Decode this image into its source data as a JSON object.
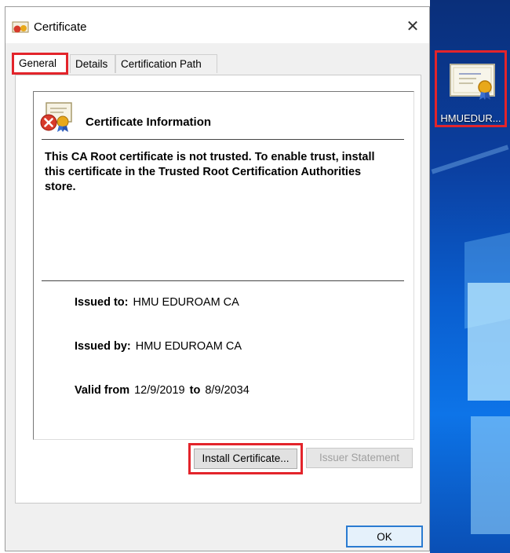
{
  "window": {
    "title": "Certificate",
    "close_symbol": "✕"
  },
  "tabs": [
    {
      "label": "General"
    },
    {
      "label": "Details"
    },
    {
      "label": "Certification Path"
    }
  ],
  "certificate": {
    "section_title": "Certificate Information",
    "warning": "This CA Root certificate is not trusted. To enable trust, install this certificate in the Trusted Root Certification Authorities store.",
    "issued_to_label": "Issued to:",
    "issued_to": "HMU EDUROAM CA",
    "issued_by_label": "Issued by:",
    "issued_by": "HMU EDUROAM CA",
    "valid_from_label": "Valid from",
    "valid_from": "12/9/2019",
    "valid_to_label": "to",
    "valid_to": "8/9/2034"
  },
  "buttons": {
    "install": "Install Certificate...",
    "issuer": "Issuer Statement",
    "ok": "OK"
  },
  "desktop": {
    "icon_label": "HMUEDUR..."
  },
  "colors": {
    "highlight": "#e3242b",
    "ok_border": "#2a7bd1"
  }
}
